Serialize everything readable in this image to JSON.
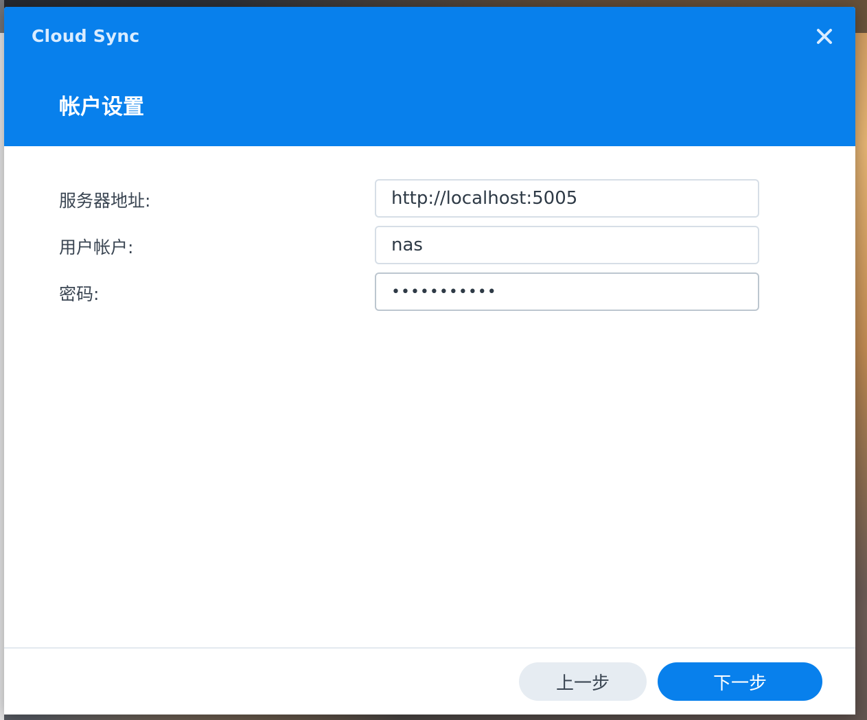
{
  "window": {
    "app_title": "Cloud Sync",
    "step_title": "帐户设置"
  },
  "form": {
    "server_label": "服务器地址:",
    "server_value": "http://localhost:5005",
    "user_label": "用户帐户:",
    "user_value": "nas",
    "password_label": "密码:",
    "password_value": "•••••••••••"
  },
  "footer": {
    "back_label": "上一步",
    "next_label": "下一步"
  },
  "colors": {
    "accent": "#0880ec",
    "header_text": "#ffffff",
    "secondary_button": "#e6ecf2"
  },
  "icons": {
    "close": "close-icon"
  }
}
